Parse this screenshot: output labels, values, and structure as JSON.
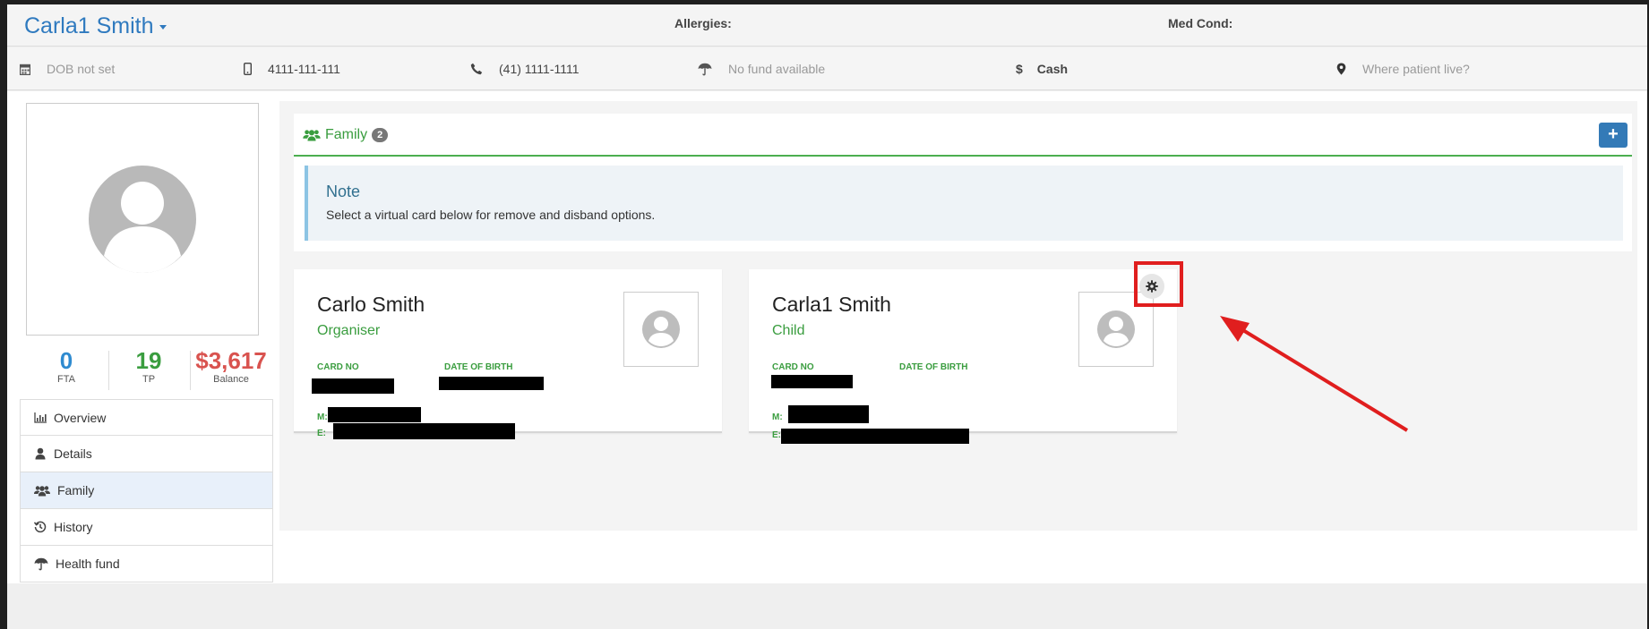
{
  "header": {
    "patient_name": "Carla1 Smith",
    "allergies_label": "Allergies:",
    "med_cond_label": "Med Cond:"
  },
  "info_bar": {
    "dob": "DOB not set",
    "mobile": "4111-111-111",
    "phone": "(41) 1111-1111",
    "fund": "No fund available",
    "payment": "Cash",
    "address": "Where patient live?"
  },
  "stats": [
    {
      "value": "0",
      "label": "FTA",
      "color": "#2f8bd0"
    },
    {
      "value": "19",
      "label": "TP",
      "color": "#3a9d3f"
    },
    {
      "value": "$3,617",
      "label": "Balance",
      "color": "#d9534f"
    }
  ],
  "nav": {
    "items": [
      {
        "label": "Overview",
        "icon": "chart-icon"
      },
      {
        "label": "Details",
        "icon": "user-icon"
      },
      {
        "label": "Family",
        "icon": "users-icon"
      },
      {
        "label": "History",
        "icon": "history-icon"
      },
      {
        "label": "Health fund",
        "icon": "umbrella-icon"
      }
    ],
    "active": "Family"
  },
  "family": {
    "title": "Family",
    "count": "2",
    "add_label": "+",
    "note_title": "Note",
    "note_text": "Select a virtual card below for remove and disband options."
  },
  "cards": [
    {
      "name": "Carlo Smith",
      "role": "Organiser",
      "card_no_label": "CARD NO",
      "dob_label": "DATE OF BIRTH",
      "m_label": "M:",
      "e_label": "E:"
    },
    {
      "name": "Carla1 Smith",
      "role": "Child",
      "card_no_label": "CARD NO",
      "dob_label": "DATE OF BIRTH",
      "m_label": "M:",
      "e_label": "E:"
    }
  ],
  "colors": {
    "brand_blue": "#2f7abf",
    "green": "#3a9d3f",
    "annotation_red": "#e01e1e"
  }
}
